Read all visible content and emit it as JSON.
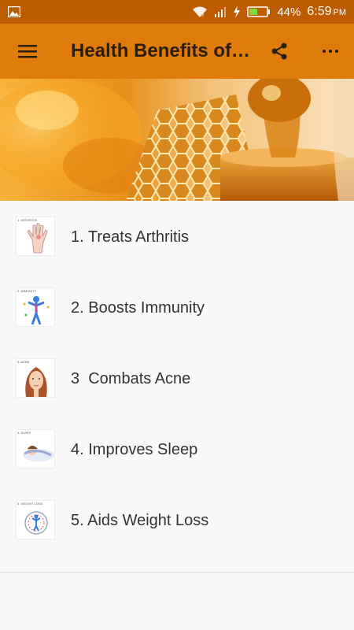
{
  "status": {
    "battery": "44%",
    "time": "6:59",
    "ampm": "PM"
  },
  "toolbar": {
    "title": "Health Benefits of…"
  },
  "items": [
    {
      "label": "1. Treats Arthritis",
      "thumb_caption": "1. ARTHRITIS"
    },
    {
      "label": "2. Boosts Immunity",
      "thumb_caption": "2. IMMUNITY"
    },
    {
      "label": "3  Combats Acne",
      "thumb_caption": "3. ACNE"
    },
    {
      "label": "4. Improves Sleep",
      "thumb_caption": "4. SLEEP"
    },
    {
      "label": "5. Aids Weight Loss",
      "thumb_caption": "5. WEIGHT LOSS"
    }
  ],
  "colors": {
    "status_bar": "#bd5b00",
    "app_bar": "#e07c0c",
    "background": "#f9f9f9"
  },
  "icons": [
    "gallery-icon",
    "wifi-icon",
    "signal-icon",
    "charging-icon",
    "battery-icon",
    "menu-icon",
    "share-icon",
    "more-vert-icon"
  ]
}
